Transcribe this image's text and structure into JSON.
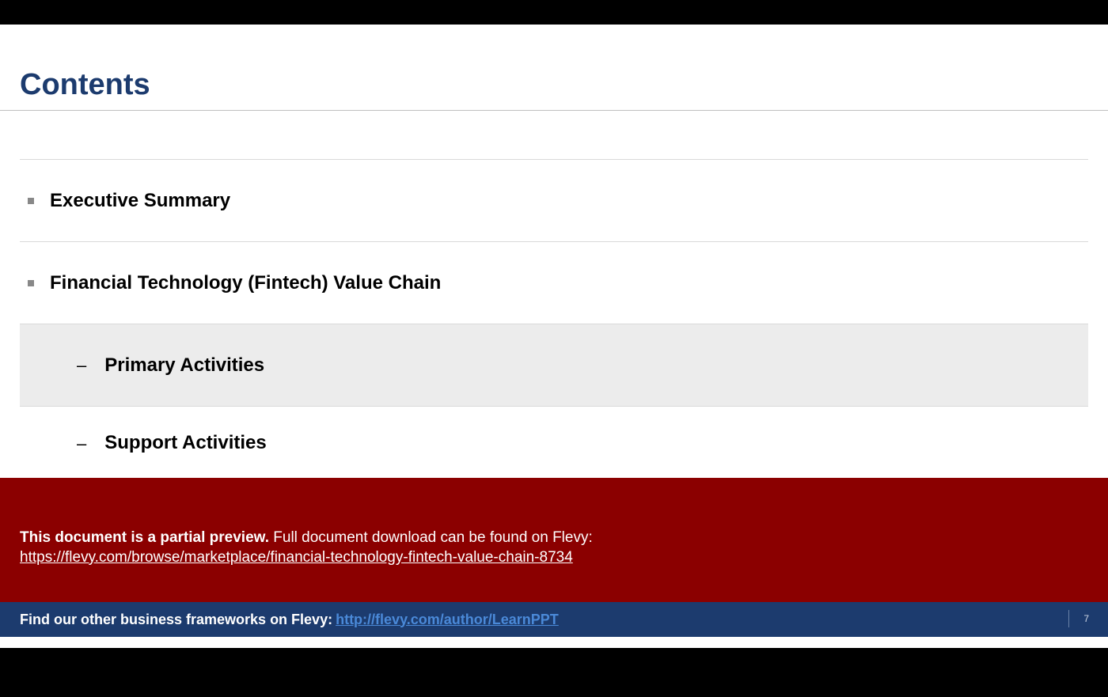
{
  "title": "Contents",
  "toc": {
    "items": [
      {
        "label": "Executive Summary"
      },
      {
        "label": "Financial Technology (Fintech) Value Chain"
      }
    ],
    "subitems": [
      {
        "label": "Primary Activities",
        "highlight": true
      },
      {
        "label": "Support Activities",
        "highlight": false
      }
    ]
  },
  "preview": {
    "bold_text": "This document is a partial preview.",
    "rest_text": "  Full document download can be found on Flevy:",
    "link": "https://flevy.com/browse/marketplace/financial-technology-fintech-value-chain-8734"
  },
  "footer": {
    "text": "Find our other business frameworks on Flevy:",
    "link_text": "http://flevy.com/author/LearnPPT"
  },
  "page_number": "7"
}
